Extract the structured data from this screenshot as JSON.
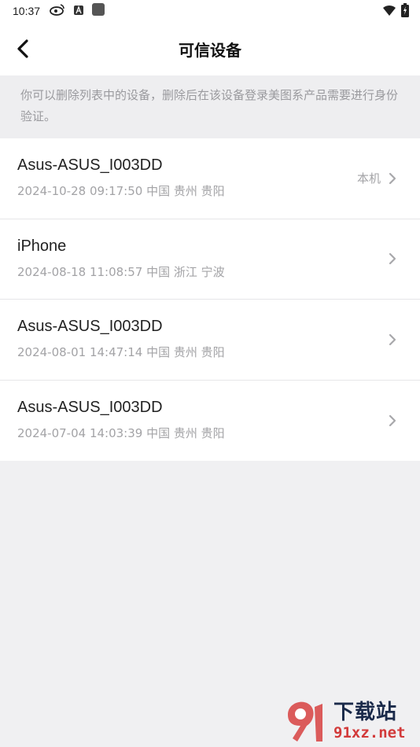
{
  "status_bar": {
    "time": "10:37",
    "icons": [
      "weibo-icon",
      "a-badge-icon",
      "app-square-icon"
    ],
    "right_icons": [
      "wifi-icon",
      "battery-charging-icon"
    ]
  },
  "header": {
    "title": "可信设备",
    "back_icon": "chevron-left-icon"
  },
  "notice": {
    "text": "你可以删除列表中的设备，删除后在该设备登录美图系产品需要进行身份验证。"
  },
  "devices": [
    {
      "name": "Asus-ASUS_I003DD",
      "meta": "2024-10-28 09:17:50 中国 贵州 贵阳",
      "badge": "本机"
    },
    {
      "name": "iPhone",
      "meta": "2024-08-18 11:08:57 中国 浙江 宁波",
      "badge": ""
    },
    {
      "name": "Asus-ASUS_I003DD",
      "meta": "2024-08-01 14:47:14 中国 贵州 贵阳",
      "badge": ""
    },
    {
      "name": "Asus-ASUS_I003DD",
      "meta": "2024-07-04 14:03:39 中国 贵州 贵阳",
      "badge": ""
    }
  ],
  "watermark": {
    "text_cn": "下载站",
    "url": "91xz.net"
  },
  "colors": {
    "background": "#f0f0f2",
    "card": "#ffffff",
    "primary_text": "#222222",
    "secondary_text": "#a3a3a6"
  }
}
